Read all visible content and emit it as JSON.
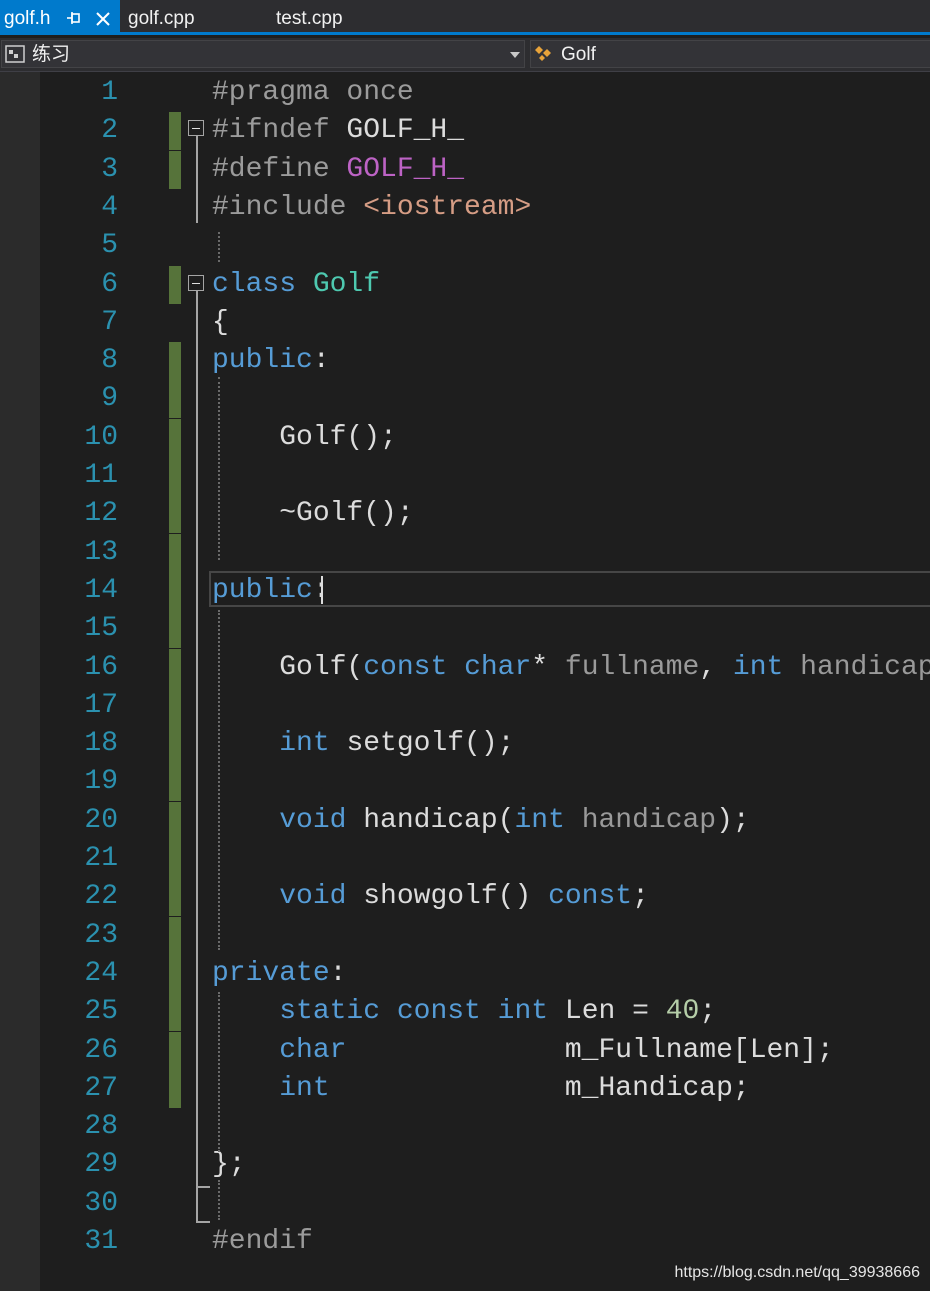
{
  "tabs": [
    {
      "label": "golf.h",
      "active": true
    },
    {
      "label": "golf.cpp",
      "active": false
    },
    {
      "label": "test.cpp",
      "active": false
    }
  ],
  "nav": {
    "project": "练习",
    "scope": "Golf"
  },
  "colors": {
    "accent": "#007acc",
    "line_number": "#2b91af",
    "keyword": "#569cd6",
    "type": "#4ec9b0",
    "macro": "#bd63c5",
    "string": "#d69d85",
    "change_bar": "#56733a"
  },
  "lines": [
    {
      "n": "1",
      "changed": false,
      "tokens": [
        {
          "t": "#pragma once",
          "c": "pp"
        }
      ]
    },
    {
      "n": "2",
      "changed": true,
      "tokens": [
        {
          "t": "#ifndef ",
          "c": "pp"
        },
        {
          "t": "GOLF_H_",
          "c": "fn"
        }
      ]
    },
    {
      "n": "3",
      "changed": true,
      "tokens": [
        {
          "t": "#define ",
          "c": "pp"
        },
        {
          "t": "GOLF_H_",
          "c": "mac"
        }
      ]
    },
    {
      "n": "4",
      "changed": false,
      "tokens": [
        {
          "t": "#include ",
          "c": "pp"
        },
        {
          "t": "<iostream>",
          "c": "str"
        }
      ]
    },
    {
      "n": "5",
      "changed": false,
      "tokens": []
    },
    {
      "n": "6",
      "changed": true,
      "tokens": [
        {
          "t": "class ",
          "c": "kw"
        },
        {
          "t": "Golf",
          "c": "typ"
        }
      ]
    },
    {
      "n": "7",
      "changed": false,
      "tokens": [
        {
          "t": "{",
          "c": "fn"
        }
      ]
    },
    {
      "n": "8",
      "changed": true,
      "tokens": [
        {
          "t": "public",
          "c": "kw"
        },
        {
          "t": ":",
          "c": "fn"
        }
      ]
    },
    {
      "n": "9",
      "changed": true,
      "tokens": []
    },
    {
      "n": "10",
      "changed": true,
      "tokens": [
        {
          "t": "    Golf();",
          "c": "fn"
        }
      ]
    },
    {
      "n": "11",
      "changed": true,
      "tokens": []
    },
    {
      "n": "12",
      "changed": true,
      "tokens": [
        {
          "t": "    ~Golf();",
          "c": "fn"
        }
      ]
    },
    {
      "n": "13",
      "changed": true,
      "tokens": []
    },
    {
      "n": "14",
      "changed": true,
      "tokens": [
        {
          "t": "public",
          "c": "kw"
        },
        {
          "t": ":",
          "c": "fn"
        }
      ]
    },
    {
      "n": "15",
      "changed": true,
      "tokens": []
    },
    {
      "n": "16",
      "changed": true,
      "tokens": [
        {
          "t": "    Golf(",
          "c": "fn"
        },
        {
          "t": "const ",
          "c": "kw"
        },
        {
          "t": "char",
          "c": "kw"
        },
        {
          "t": "* ",
          "c": "fn"
        },
        {
          "t": "fullname",
          "c": "prm"
        },
        {
          "t": ", ",
          "c": "fn"
        },
        {
          "t": "int ",
          "c": "kw"
        },
        {
          "t": "handicap",
          "c": "prm"
        },
        {
          "t": ");",
          "c": "fn"
        }
      ]
    },
    {
      "n": "17",
      "changed": true,
      "tokens": []
    },
    {
      "n": "18",
      "changed": true,
      "tokens": [
        {
          "t": "    ",
          "c": "fn"
        },
        {
          "t": "int ",
          "c": "kw"
        },
        {
          "t": "setgolf();",
          "c": "fn"
        }
      ]
    },
    {
      "n": "19",
      "changed": true,
      "tokens": []
    },
    {
      "n": "20",
      "changed": true,
      "tokens": [
        {
          "t": "    ",
          "c": "fn"
        },
        {
          "t": "void ",
          "c": "kw"
        },
        {
          "t": "handicap(",
          "c": "fn"
        },
        {
          "t": "int ",
          "c": "kw"
        },
        {
          "t": "handicap",
          "c": "prm"
        },
        {
          "t": ");",
          "c": "fn"
        }
      ]
    },
    {
      "n": "21",
      "changed": true,
      "tokens": []
    },
    {
      "n": "22",
      "changed": true,
      "tokens": [
        {
          "t": "    ",
          "c": "fn"
        },
        {
          "t": "void ",
          "c": "kw"
        },
        {
          "t": "showgolf() ",
          "c": "fn"
        },
        {
          "t": "const",
          "c": "kw"
        },
        {
          "t": ";",
          "c": "fn"
        }
      ]
    },
    {
      "n": "23",
      "changed": true,
      "tokens": []
    },
    {
      "n": "24",
      "changed": true,
      "tokens": [
        {
          "t": "private",
          "c": "kw"
        },
        {
          "t": ":",
          "c": "fn"
        }
      ]
    },
    {
      "n": "25",
      "changed": true,
      "tokens": [
        {
          "t": "    ",
          "c": "fn"
        },
        {
          "t": "static ",
          "c": "kw"
        },
        {
          "t": "const ",
          "c": "kw"
        },
        {
          "t": "int ",
          "c": "kw"
        },
        {
          "t": "Len = ",
          "c": "fn"
        },
        {
          "t": "40",
          "c": "num"
        },
        {
          "t": ";",
          "c": "fn"
        }
      ]
    },
    {
      "n": "26",
      "changed": true,
      "tokens": [
        {
          "t": "    ",
          "c": "fn"
        },
        {
          "t": "char",
          "c": "kw"
        },
        {
          "t": "             m_Fullname[Len];",
          "c": "fn"
        }
      ]
    },
    {
      "n": "27",
      "changed": true,
      "tokens": [
        {
          "t": "    ",
          "c": "fn"
        },
        {
          "t": "int",
          "c": "kw"
        },
        {
          "t": "              m_Handicap;",
          "c": "fn"
        }
      ]
    },
    {
      "n": "28",
      "changed": false,
      "tokens": []
    },
    {
      "n": "29",
      "changed": false,
      "tokens": [
        {
          "t": "};",
          "c": "fn"
        }
      ]
    },
    {
      "n": "30",
      "changed": false,
      "tokens": []
    },
    {
      "n": "31",
      "changed": false,
      "tokens": [
        {
          "t": "#endif",
          "c": "pp"
        }
      ]
    }
  ],
  "watermark": "https://blog.csdn.net/qq_39938666"
}
